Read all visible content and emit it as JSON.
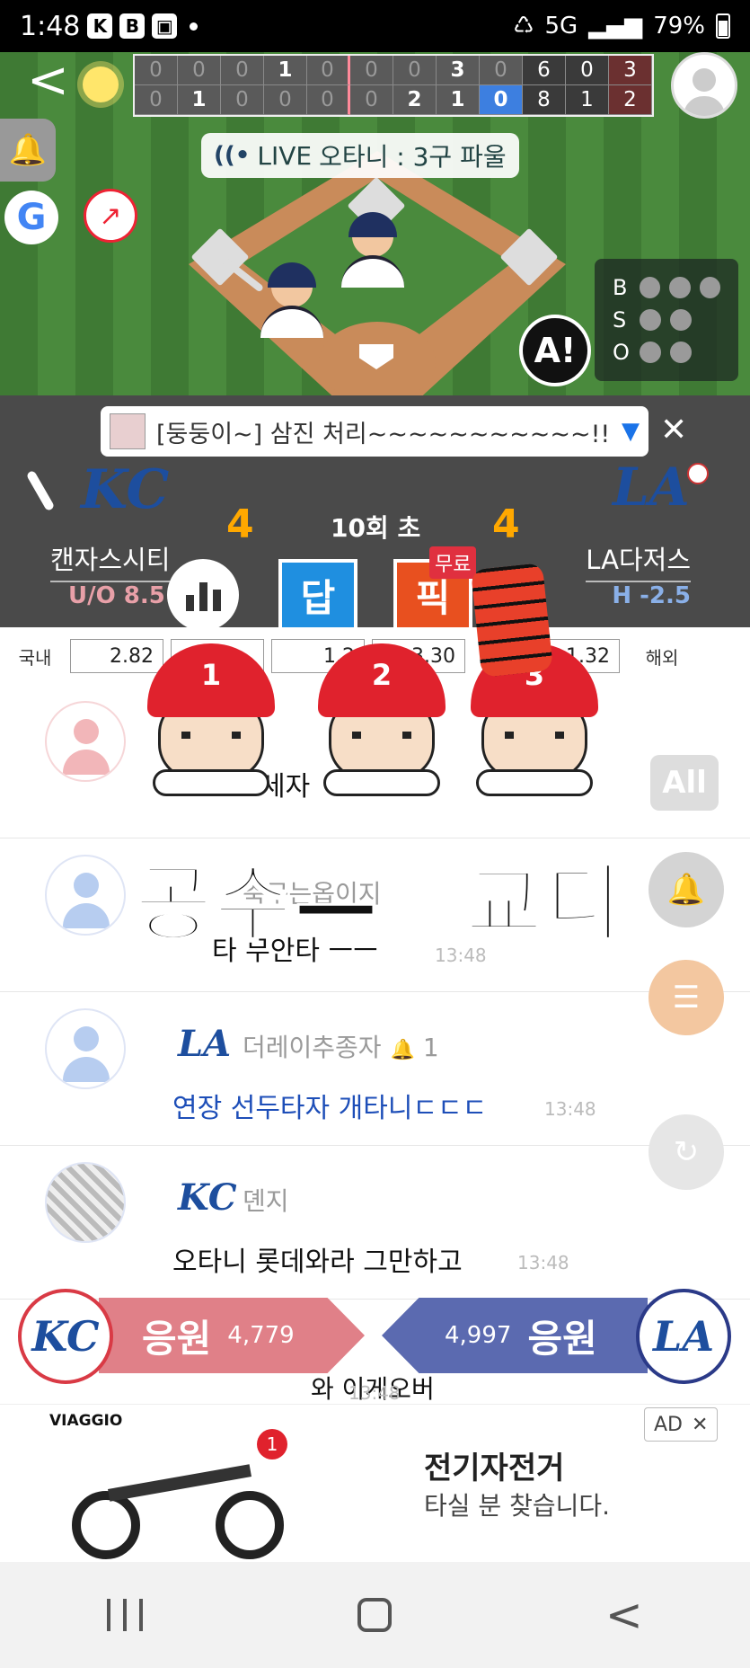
{
  "status_bar": {
    "time": "1:48",
    "badges": [
      "K",
      "B"
    ],
    "network": "5G",
    "battery": "79%"
  },
  "scoreboard": {
    "away_innings": [
      "0",
      "0",
      "0",
      "1",
      "0",
      "0",
      "0",
      "3",
      "0"
    ],
    "away_totals": [
      "6",
      "0",
      "3"
    ],
    "home_innings": [
      "0",
      "1",
      "0",
      "0",
      "0",
      "0",
      "2",
      "1",
      "0"
    ],
    "home_totals": [
      "8",
      "1",
      "2"
    ]
  },
  "live": {
    "label": "LIVE",
    "text": "오타니 : 3구 파울"
  },
  "bso": {
    "b": "B",
    "s": "S",
    "o": "O"
  },
  "ai_button": "A!",
  "notice": {
    "text": "[둥둥이~] 삼진 처리~~~~~~~~~~~!!! 교"
  },
  "game": {
    "inning": "10회 초",
    "away": {
      "name": "캔자스시티",
      "score": "4",
      "odds": "U/O 8.5",
      "logo": "KC"
    },
    "home": {
      "name": "LA다저스",
      "score": "4",
      "odds": "H -2.5",
      "logo": "LA"
    },
    "answer_button": "답",
    "pick_button": "픽",
    "free_tag": "무료"
  },
  "odds_row": {
    "domestic_label": "국내",
    "overseas_label": "해외",
    "values": [
      "2.82",
      "",
      "1.2",
      "3.30",
      "1.32"
    ]
  },
  "overlay": {
    "caps": [
      "1",
      "2",
      "3"
    ],
    "left_word": "공수—",
    "right_word": "교디"
  },
  "chat": [
    {
      "nick": "",
      "text": "세자",
      "time": "",
      "style": "pink",
      "logo": ""
    },
    {
      "nick": "축구는옵이지",
      "text": "타 무안타 ㅡㅡ",
      "time": "13:48",
      "style": "blue",
      "logo": ""
    },
    {
      "nick": "더레이추종자",
      "text": "연장 선두타자 개타니ㄷㄷㄷ",
      "time": "13:48",
      "style": "blue",
      "logo": "LA",
      "bell_count": "1"
    },
    {
      "nick": "뎬지",
      "text": "오타니 롯데와라 그만하고",
      "time": "13:48",
      "style": "photo",
      "logo": "KC"
    },
    {
      "nick": "",
      "text": "와 이게오버",
      "time": "13:48",
      "style": "blue",
      "logo": ""
    }
  ],
  "float_all": "All",
  "cheer": {
    "away_label": "응원",
    "away_count": "4,779",
    "home_label": "응원",
    "home_count": "4,997"
  },
  "ad": {
    "brand": "VIAGGIO",
    "title": "전기자전거",
    "subtitle": "타실 분 찾습니다.",
    "tag": "AD",
    "badge": "1"
  },
  "colors": {
    "accent_blue": "#3d7fe0",
    "kc_blue": "#1d4e9e",
    "away_cheer": "#e08088",
    "home_cheer": "#5b6ab0",
    "score_orange": "#ffa800"
  }
}
